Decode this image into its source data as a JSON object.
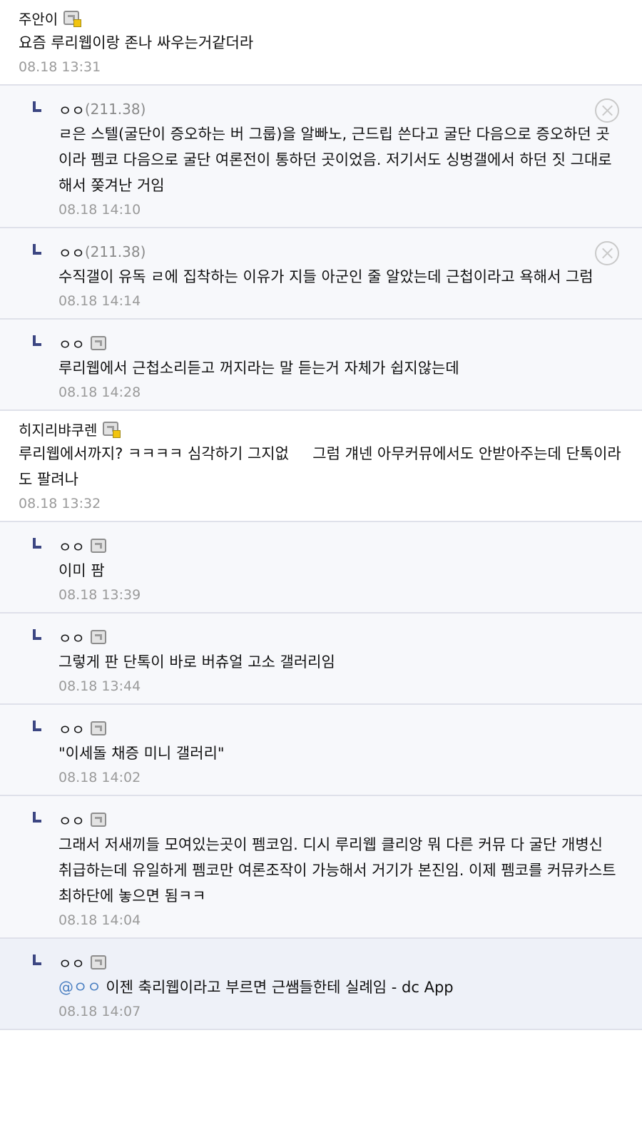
{
  "comments": [
    {
      "nick": "주안이",
      "ip": "",
      "text": "요즘 루리웹이랑 존나 싸우는거같더라",
      "date": "08.18 13:31",
      "replies": [
        {
          "nick": "ㅇㅇ",
          "ip": "(211.38)",
          "text": "ㄹ은 스텔(굴단이 증오하는 버 그룹)을 알빠노, 근드립 쓴다고 굴단 다음으로 증오하던 곳이라 펨코 다음으로 굴단 여론전이 통하던 곳이었음. 저기서도 싱벙갤에서 하던 짓 그대로해서 쫒겨난 거임",
          "date": "08.18 14:10"
        },
        {
          "nick": "ㅇㅇ",
          "ip": "(211.38)",
          "text": "수직갤이 유독 ㄹ에 집착하는 이유가 지들 아군인 줄 알았는데 근첩이라고 욕해서 그럼",
          "date": "08.18 14:14"
        },
        {
          "nick": "ㅇㅇ",
          "ip": "",
          "text": "루리웹에서 근첩소리듣고 꺼지라는 말 듣는거 자체가 쉽지않는데",
          "date": "08.18 14:28"
        }
      ]
    },
    {
      "nick": "히지리뱌쿠렌",
      "ip": "",
      "text": "루리웹에서까지? ㅋㅋㅋㅋ 심각하기 그지없     그럼 걔넨 아무커뮤에서도 안받아주는데 단톡이라도 팔려나",
      "date": "08.18 13:32",
      "replies": [
        {
          "nick": "ㅇㅇ",
          "ip": "",
          "text": "이미 팜",
          "date": "08.18 13:39"
        },
        {
          "nick": "ㅇㅇ",
          "ip": "",
          "text": "그렇게 판 단톡이 바로 버츄얼 고소 갤러리임",
          "date": "08.18 13:44"
        },
        {
          "nick": "ㅇㅇ",
          "ip": "",
          "text": "\"이세돌 채증 미니 갤러리\"",
          "date": "08.18 14:02"
        },
        {
          "nick": "ㅇㅇ",
          "ip": "",
          "text": "그래서 저새끼들 모여있는곳이 펨코임. 디시 루리웹 클리앙 뭐 다른 커뮤 다 굴단 개병신 취급하는데 유일하게 펨코만 여론조작이 가능해서 거기가 본진임. 이제 펨코를 커뮤카스트 최하단에 놓으면 됨ㅋㅋ",
          "date": "08.18 14:04"
        },
        {
          "nick": "ㅇㅇ",
          "ip": "",
          "mention": "@ㅇㅇ",
          "text": "이젠 축리웹이라고 부르면 근쌤들한테 실례임 - dc App",
          "date": "08.18 14:07"
        }
      ]
    }
  ]
}
